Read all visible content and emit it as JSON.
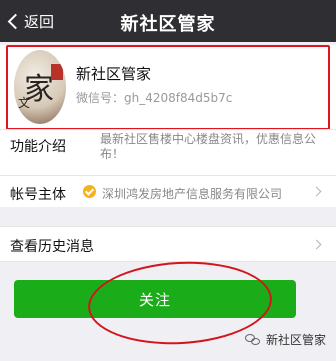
{
  "navbar": {
    "back_label": "返回",
    "title": "新社区管家"
  },
  "profile": {
    "name": "新社区管家",
    "id_line": "微信号：gh_4208f84d5b7c",
    "avatar_glyph_large": "家",
    "avatar_glyph_small": "文"
  },
  "info": {
    "function_label": "功能介绍",
    "function_text": "最新社区售楼中心楼盘资讯，优惠信息公布！",
    "owner_label": "帐号主体",
    "owner_text": "深圳鸿发房地产信息服务有限公司"
  },
  "history": {
    "label": "查看历史消息"
  },
  "follow_button": {
    "label": "关注"
  },
  "watermark": {
    "text": "新社区管家"
  },
  "colors": {
    "navbar": "#2f2f33",
    "follow_green": "#1aad19",
    "annotation_red": "#e0141c",
    "verify_yellow": "#f4b21d"
  }
}
